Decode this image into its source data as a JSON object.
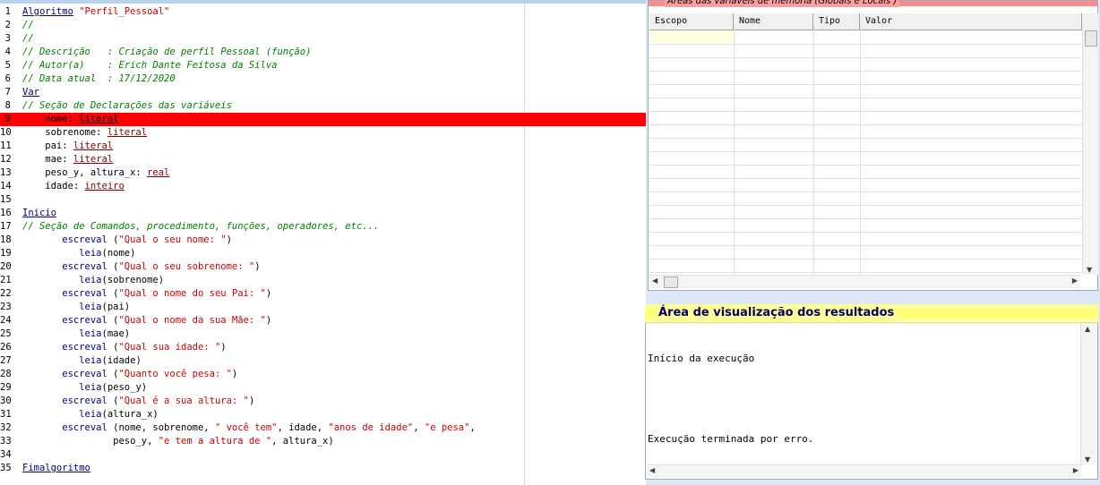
{
  "editor": {
    "lines": [
      {
        "n": "1",
        "tokens": [
          {
            "t": "Algoritmo",
            "c": "kw"
          },
          {
            "t": " \"Perfil_Pessoal\"",
            "c": "str"
          }
        ]
      },
      {
        "n": "2",
        "tokens": [
          {
            "t": "//",
            "c": "cm"
          }
        ]
      },
      {
        "n": "3",
        "tokens": [
          {
            "t": "//",
            "c": "cm"
          }
        ]
      },
      {
        "n": "4",
        "tokens": [
          {
            "t": "// Descrição   : Criação de perfil Pessoal (função)",
            "c": "cm"
          }
        ]
      },
      {
        "n": "5",
        "tokens": [
          {
            "t": "// Autor(a)    : Erich Dante Feitosa da Silva",
            "c": "cm"
          }
        ]
      },
      {
        "n": "6",
        "tokens": [
          {
            "t": "// Data atual  : 17/12/2020",
            "c": "cm"
          }
        ]
      },
      {
        "n": "7",
        "tokens": [
          {
            "t": "Var",
            "c": "kw"
          }
        ]
      },
      {
        "n": "8",
        "tokens": [
          {
            "t": "// Seção de Declarações das variáveis",
            "c": "cm"
          }
        ]
      },
      {
        "n": "9",
        "hl": true,
        "tokens": [
          {
            "t": "    nome: ",
            "c": "tx"
          },
          {
            "t": "literal",
            "c": "ty"
          }
        ]
      },
      {
        "n": "10",
        "tokens": [
          {
            "t": "    sobrenome: ",
            "c": "tx"
          },
          {
            "t": "literal",
            "c": "ty"
          }
        ]
      },
      {
        "n": "11",
        "tokens": [
          {
            "t": "    pai: ",
            "c": "tx"
          },
          {
            "t": "literal",
            "c": "ty"
          }
        ]
      },
      {
        "n": "12",
        "tokens": [
          {
            "t": "    mae: ",
            "c": "tx"
          },
          {
            "t": "literal",
            "c": "ty"
          }
        ]
      },
      {
        "n": "13",
        "tokens": [
          {
            "t": "    peso_y, altura_x: ",
            "c": "tx"
          },
          {
            "t": "real",
            "c": "ty"
          }
        ]
      },
      {
        "n": "14",
        "tokens": [
          {
            "t": "    idade: ",
            "c": "tx"
          },
          {
            "t": "inteiro",
            "c": "ty"
          }
        ]
      },
      {
        "n": "15",
        "tokens": []
      },
      {
        "n": "16",
        "tokens": [
          {
            "t": "Inicio",
            "c": "kw"
          }
        ]
      },
      {
        "n": "17",
        "tokens": [
          {
            "t": "// Seção de Comandos, procedimento, funções, operadores, etc...",
            "c": "cm"
          }
        ]
      },
      {
        "n": "18",
        "tokens": [
          {
            "t": "       escreval",
            "c": "fn"
          },
          {
            "t": " (",
            "c": "tx"
          },
          {
            "t": "\"Qual o seu nome: \"",
            "c": "str"
          },
          {
            "t": ")",
            "c": "tx"
          }
        ]
      },
      {
        "n": "19",
        "tokens": [
          {
            "t": "          leia",
            "c": "fn"
          },
          {
            "t": "(nome)",
            "c": "tx"
          }
        ]
      },
      {
        "n": "20",
        "tokens": [
          {
            "t": "       escreval",
            "c": "fn"
          },
          {
            "t": " (",
            "c": "tx"
          },
          {
            "t": "\"Qual o seu sobrenome: \"",
            "c": "str"
          },
          {
            "t": ")",
            "c": "tx"
          }
        ]
      },
      {
        "n": "21",
        "tokens": [
          {
            "t": "          leia",
            "c": "fn"
          },
          {
            "t": "(sobrenome)",
            "c": "tx"
          }
        ]
      },
      {
        "n": "22",
        "tokens": [
          {
            "t": "       escreval",
            "c": "fn"
          },
          {
            "t": " (",
            "c": "tx"
          },
          {
            "t": "\"Qual o nome do seu Pai: \"",
            "c": "str"
          },
          {
            "t": ")",
            "c": "tx"
          }
        ]
      },
      {
        "n": "23",
        "tokens": [
          {
            "t": "          leia",
            "c": "fn"
          },
          {
            "t": "(pai)",
            "c": "tx"
          }
        ]
      },
      {
        "n": "24",
        "tokens": [
          {
            "t": "       escreval",
            "c": "fn"
          },
          {
            "t": " (",
            "c": "tx"
          },
          {
            "t": "\"Qual o nome da sua Mãe: \"",
            "c": "str"
          },
          {
            "t": ")",
            "c": "tx"
          }
        ]
      },
      {
        "n": "25",
        "tokens": [
          {
            "t": "          leia",
            "c": "fn"
          },
          {
            "t": "(mae)",
            "c": "tx"
          }
        ]
      },
      {
        "n": "26",
        "tokens": [
          {
            "t": "       escreval",
            "c": "fn"
          },
          {
            "t": " (",
            "c": "tx"
          },
          {
            "t": "\"Qual sua idade: \"",
            "c": "str"
          },
          {
            "t": ")",
            "c": "tx"
          }
        ]
      },
      {
        "n": "27",
        "tokens": [
          {
            "t": "          leia",
            "c": "fn"
          },
          {
            "t": "(idade)",
            "c": "tx"
          }
        ]
      },
      {
        "n": "28",
        "tokens": [
          {
            "t": "       escreval",
            "c": "fn"
          },
          {
            "t": " (",
            "c": "tx"
          },
          {
            "t": "\"Quanto você pesa: \"",
            "c": "str"
          },
          {
            "t": ")",
            "c": "tx"
          }
        ]
      },
      {
        "n": "29",
        "tokens": [
          {
            "t": "          leia",
            "c": "fn"
          },
          {
            "t": "(peso_y)",
            "c": "tx"
          }
        ]
      },
      {
        "n": "30",
        "tokens": [
          {
            "t": "       escreval",
            "c": "fn"
          },
          {
            "t": " (",
            "c": "tx"
          },
          {
            "t": "\"Qual é a sua altura: \"",
            "c": "str"
          },
          {
            "t": ")",
            "c": "tx"
          }
        ]
      },
      {
        "n": "31",
        "tokens": [
          {
            "t": "          leia",
            "c": "fn"
          },
          {
            "t": "(altura_x)",
            "c": "tx"
          }
        ]
      },
      {
        "n": "32",
        "tokens": [
          {
            "t": "       escreval",
            "c": "fn"
          },
          {
            "t": " (nome, sobrenome, ",
            "c": "tx"
          },
          {
            "t": "\" você tem\"",
            "c": "str"
          },
          {
            "t": ", idade, ",
            "c": "tx"
          },
          {
            "t": "\"anos de idade\"",
            "c": "str"
          },
          {
            "t": ", ",
            "c": "tx"
          },
          {
            "t": "\"e pesa\"",
            "c": "str"
          },
          {
            "t": ",",
            "c": "tx"
          }
        ]
      },
      {
        "n": "33",
        "tokens": [
          {
            "t": "                peso_y, ",
            "c": "tx"
          },
          {
            "t": "\"e tem a altura de \"",
            "c": "str"
          },
          {
            "t": ", altura_x)",
            "c": "tx"
          }
        ]
      },
      {
        "n": "34",
        "tokens": []
      },
      {
        "n": "35",
        "tokens": [
          {
            "t": "Fimalgoritmo",
            "c": "kw"
          }
        ]
      }
    ]
  },
  "variables": {
    "title": "Áreas das variáveis de memória (Globais e Locais )",
    "columns": [
      "Escopo",
      "Nome",
      "Tipo",
      "Valor"
    ]
  },
  "results": {
    "title": "Área de visualização dos resultados",
    "output": [
      "Início da execução",
      "",
      "Execução terminada por erro."
    ]
  }
}
